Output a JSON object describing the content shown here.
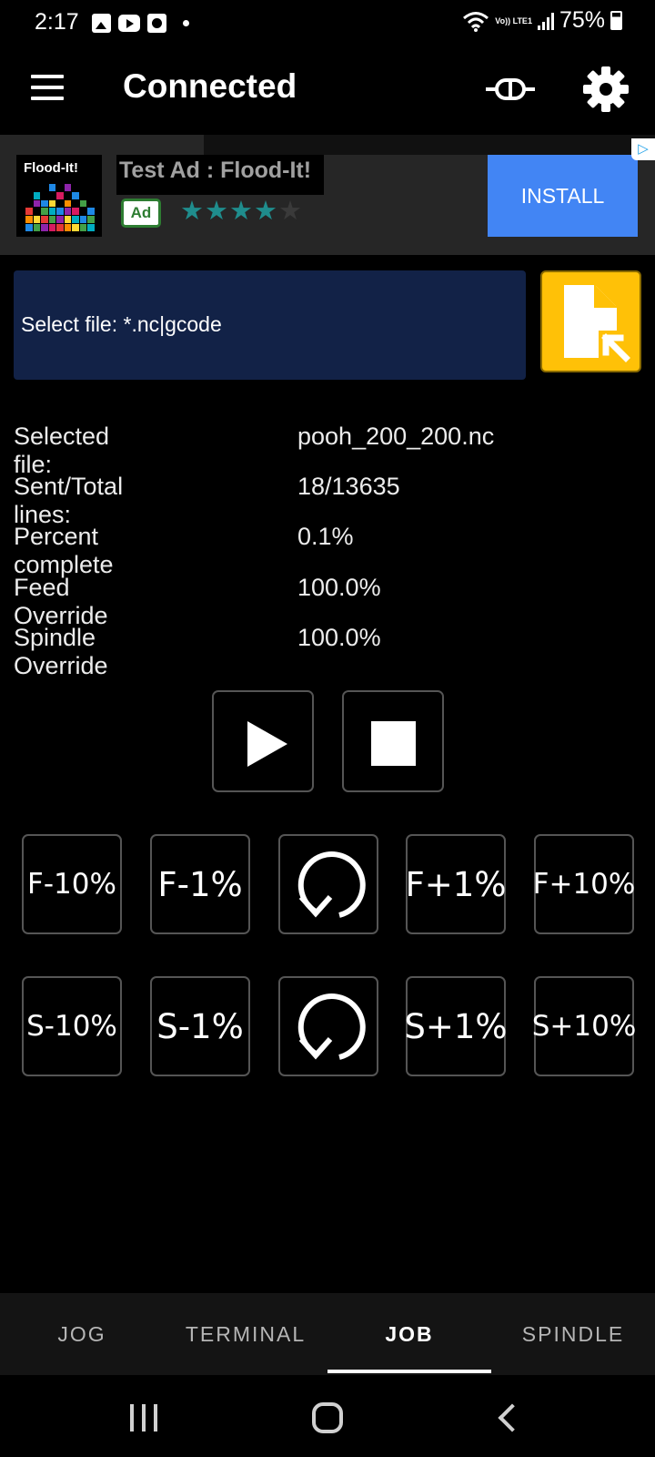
{
  "status_bar": {
    "time": "2:17",
    "network": "Vo)) LTE1",
    "battery": "75%"
  },
  "toolbar": {
    "title": "Connected",
    "menu_icon": "menu-icon",
    "connect_icon": "usb-connect-icon",
    "settings_icon": "gear-icon"
  },
  "ad": {
    "logo_text": "Flood-It!",
    "title": "Test Ad : Flood-It!",
    "badge": "Ad",
    "rating": 4,
    "install_label": "INSTALL",
    "accent_color": "#4285f4"
  },
  "file_select": {
    "label": "Select file: *.nc|gcode",
    "button_icon": "file-open-icon",
    "button_color": "#ffc107"
  },
  "job_info": [
    {
      "label": "Selected file:",
      "value": "pooh_200_200.nc"
    },
    {
      "label": "Sent/Total lines:",
      "value": "18/13635"
    },
    {
      "label": "Percent complete",
      "value": "0.1%"
    },
    {
      "label": "Feed Override",
      "value": "100.0%"
    },
    {
      "label": "Spindle Override",
      "value": "100.0%"
    }
  ],
  "controls": {
    "play_icon": "play-icon",
    "stop_icon": "stop-icon"
  },
  "feed_overrides": [
    "F-10%",
    "F-1%",
    "F+1%",
    "F+10%"
  ],
  "spindle_overrides": [
    "S-10%",
    "S-1%",
    "S+1%",
    "S+10%"
  ],
  "reset_icon": "reset-icon",
  "tabs": [
    {
      "label": "JOG",
      "active": false
    },
    {
      "label": "TERMINAL",
      "active": false
    },
    {
      "label": "JOB",
      "active": true
    },
    {
      "label": "SPINDLE",
      "active": false
    }
  ]
}
